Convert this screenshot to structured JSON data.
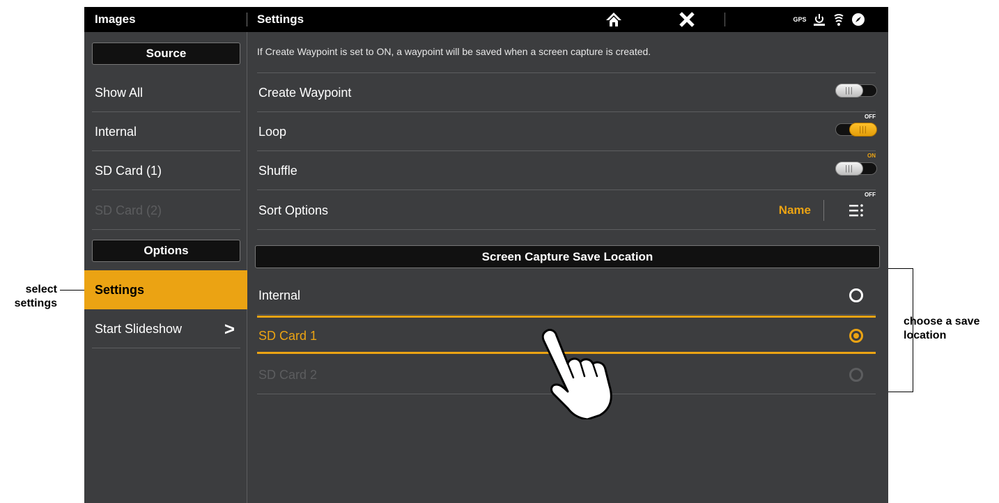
{
  "topbar": {
    "left_title": "Images",
    "right_title": "Settings",
    "gps_label": "GPS"
  },
  "sidebar": {
    "source_header": "Source",
    "source_items": [
      {
        "label": "Show All",
        "enabled": true
      },
      {
        "label": "Internal",
        "enabled": true
      },
      {
        "label": "SD Card (1)",
        "enabled": true
      },
      {
        "label": "SD Card (2)",
        "enabled": false
      }
    ],
    "options_header": "Options",
    "settings_label": "Settings",
    "slideshow_label": "Start Slideshow",
    "slideshow_chevron": ">"
  },
  "main": {
    "info_text": "If Create Waypoint is set to ON, a waypoint will be saved when a screen capture is created.",
    "rows": [
      {
        "label": "Create Waypoint",
        "state": "OFF"
      },
      {
        "label": "Loop",
        "state": "ON"
      },
      {
        "label": "Shuffle",
        "state": "OFF"
      }
    ],
    "sort": {
      "label": "Sort Options",
      "value": "Name"
    },
    "save_header": "Screen Capture Save Location",
    "locations": [
      {
        "label": "Internal",
        "selected": false,
        "enabled": true
      },
      {
        "label": "SD Card 1",
        "selected": true,
        "enabled": true
      },
      {
        "label": "SD Card 2",
        "selected": false,
        "enabled": false
      }
    ]
  },
  "annotations": {
    "left_line1": "select",
    "left_line2": "settings",
    "right_line1": "choose a save",
    "right_line2": "location"
  },
  "colors": {
    "accent": "#eba313",
    "background": "#3c3d3f",
    "bar": "#000000",
    "disabled_text": "#5c5d5f"
  },
  "icons": [
    "home-icon",
    "close-icon",
    "gps-icon",
    "power-icon",
    "sonar-icon",
    "compass-icon",
    "sort-menu-icon",
    "touch-hand-icon"
  ]
}
